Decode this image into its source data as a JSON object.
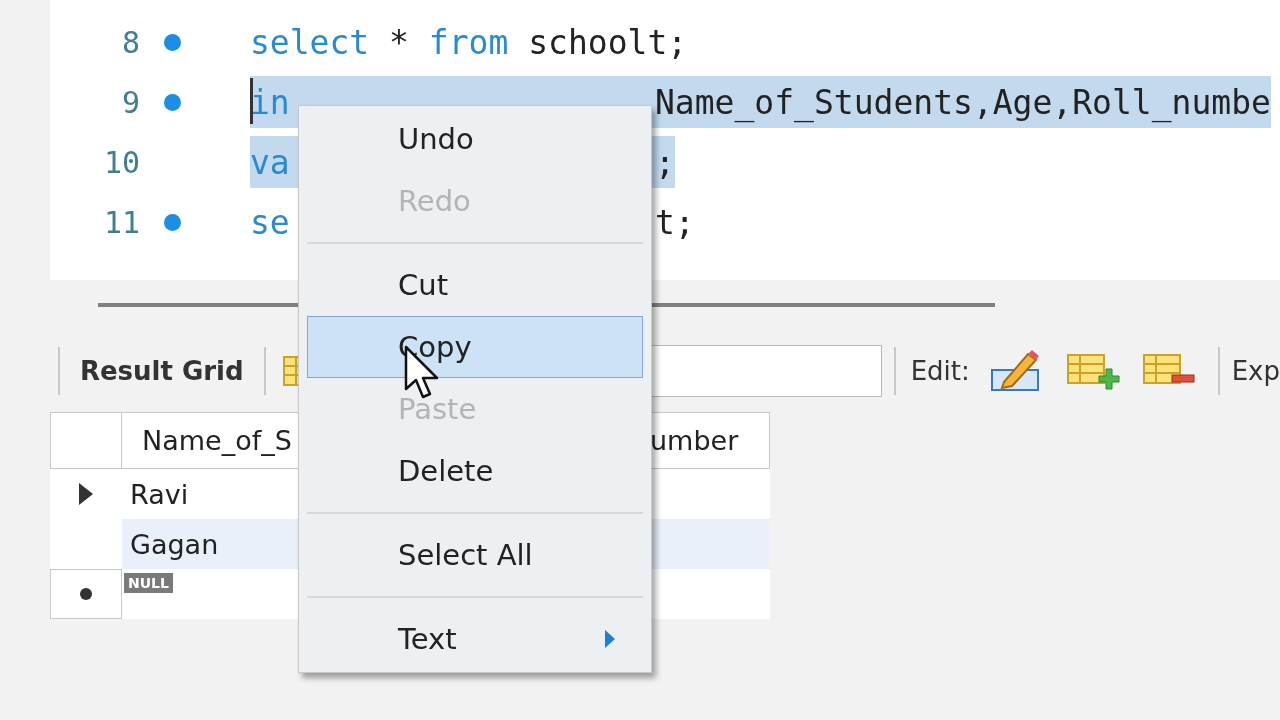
{
  "editor": {
    "lines": [
      {
        "number": "8",
        "breakpoint": true,
        "selected": false,
        "left": [
          {
            "text": "select",
            "kind": "keyword"
          },
          {
            "text": " * ",
            "kind": "plain"
          },
          {
            "text": "from",
            "kind": "keyword"
          },
          {
            "text": " schoolt;",
            "kind": "plain"
          }
        ]
      },
      {
        "number": "9",
        "breakpoint": true,
        "selected": true,
        "cursor": true,
        "left": [
          {
            "text": "in",
            "kind": "keyword"
          }
        ],
        "right": [
          {
            "text": "Name_of_Students,Age,Roll_numbe",
            "kind": "plain"
          }
        ]
      },
      {
        "number": "10",
        "breakpoint": false,
        "selected": true,
        "left": [
          {
            "text": "va",
            "kind": "keyword"
          }
        ],
        "right": [
          {
            "text": ";",
            "kind": "plain"
          }
        ]
      },
      {
        "number": "11",
        "breakpoint": true,
        "selected": false,
        "left": [
          {
            "text": "se",
            "kind": "keyword"
          }
        ],
        "right": [
          {
            "text": "t;",
            "kind": "plain"
          }
        ]
      }
    ]
  },
  "results": {
    "toolbar": {
      "title": "Result Grid",
      "edit_label": "Edit:",
      "export_label": "Exp"
    },
    "grid": {
      "columns": [
        "Name_of_S",
        "umber"
      ],
      "rows": [
        {
          "kind": "current",
          "selected": false,
          "cells": [
            "Ravi"
          ]
        },
        {
          "kind": "plain",
          "selected": true,
          "cells": [
            "Gagan"
          ]
        },
        {
          "kind": "new",
          "selected": false,
          "null_badge": "NULL"
        }
      ]
    }
  },
  "context_menu": {
    "items": [
      {
        "kind": "item",
        "label": "Undo",
        "disabled": false,
        "selected": false
      },
      {
        "kind": "item",
        "label": "Redo",
        "disabled": true,
        "selected": false
      },
      {
        "kind": "separator"
      },
      {
        "kind": "item",
        "label": "Cut",
        "disabled": false,
        "selected": false
      },
      {
        "kind": "item",
        "label": "Copy",
        "disabled": false,
        "selected": true
      },
      {
        "kind": "item",
        "label": "Paste",
        "disabled": true,
        "selected": false
      },
      {
        "kind": "item",
        "label": "Delete",
        "disabled": false,
        "selected": false
      },
      {
        "kind": "separator"
      },
      {
        "kind": "item",
        "label": "Select All",
        "disabled": false,
        "selected": false
      },
      {
        "kind": "separator"
      },
      {
        "kind": "submenu",
        "label": "Text",
        "disabled": false,
        "selected": false
      }
    ]
  }
}
